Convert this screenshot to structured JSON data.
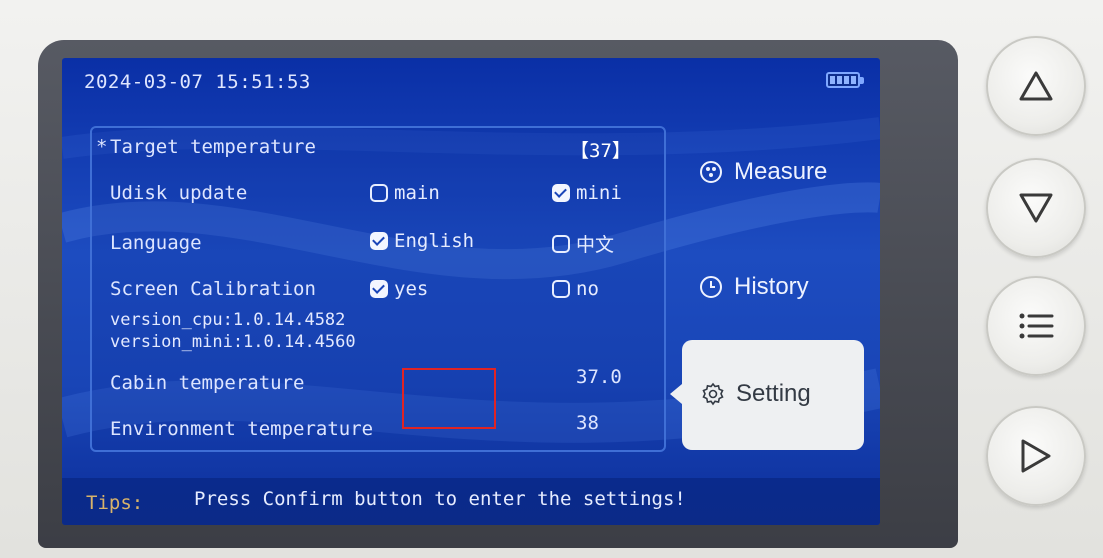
{
  "status_bar": {
    "datetime": "2024-03-07 15:51:53",
    "battery_icon": "battery-icon"
  },
  "settings": {
    "target_temperature": {
      "marker": "*",
      "label": "Target temperature",
      "value": "【37】"
    },
    "udisk_update": {
      "label": "Udisk update",
      "options": [
        {
          "label": "main",
          "checked": false
        },
        {
          "label": "mini",
          "checked": true
        }
      ]
    },
    "language": {
      "label": "Language",
      "options": [
        {
          "label": "English",
          "checked": true
        },
        {
          "label": "中文",
          "checked": false
        }
      ]
    },
    "screen_calibration": {
      "label": "Screen Calibration",
      "options": [
        {
          "label": "yes",
          "checked": true
        },
        {
          "label": "no",
          "checked": false
        }
      ]
    },
    "version_cpu": "version_cpu:1.0.14.4582",
    "version_mini": "version_mini:1.0.14.4560",
    "cabin_temperature": {
      "label": "Cabin temperature",
      "value": "37.0"
    },
    "environment_temperature": {
      "label": "Environment temperature",
      "value": "38"
    }
  },
  "menu": {
    "measure": {
      "label": "Measure",
      "icon": "measure-icon"
    },
    "history": {
      "label": "History",
      "icon": "clock-icon"
    },
    "setting": {
      "label": "Setting",
      "icon": "gear-icon",
      "selected": true
    }
  },
  "tips": {
    "label": "Tips:",
    "text": "Press Confirm button to enter the settings!"
  },
  "hardware_buttons": [
    "up-button",
    "down-button",
    "menu-button",
    "confirm-button"
  ],
  "colors": {
    "screen_blue": "#1d4cc0",
    "highlight_red": "#e02424",
    "tips_label": "#d8b36a",
    "selected_card": "#eef0f2"
  }
}
